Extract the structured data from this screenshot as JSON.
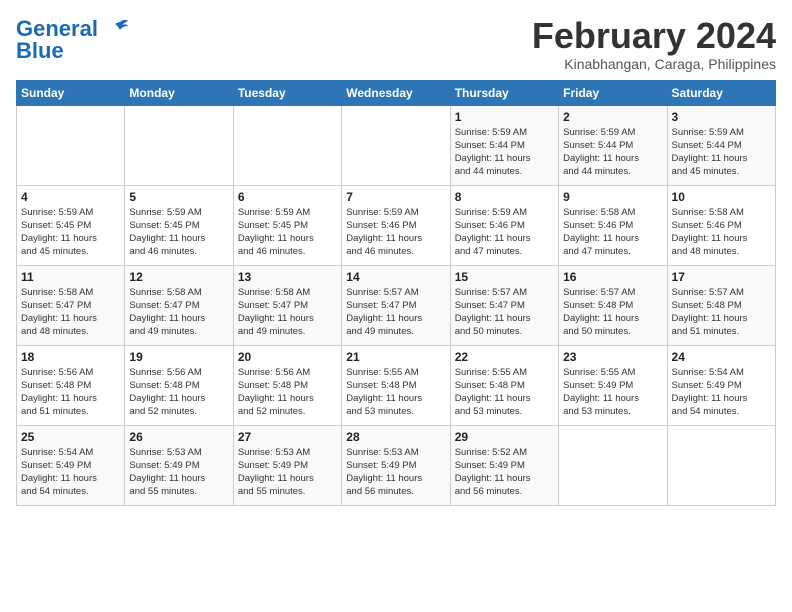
{
  "logo": {
    "line1": "General",
    "line2": "Blue"
  },
  "title": "February 2024",
  "subtitle": "Kinabhangan, Caraga, Philippines",
  "days_header": [
    "Sunday",
    "Monday",
    "Tuesday",
    "Wednesday",
    "Thursday",
    "Friday",
    "Saturday"
  ],
  "weeks": [
    [
      {
        "day": "",
        "info": ""
      },
      {
        "day": "",
        "info": ""
      },
      {
        "day": "",
        "info": ""
      },
      {
        "day": "",
        "info": ""
      },
      {
        "day": "1",
        "info": "Sunrise: 5:59 AM\nSunset: 5:44 PM\nDaylight: 11 hours\nand 44 minutes."
      },
      {
        "day": "2",
        "info": "Sunrise: 5:59 AM\nSunset: 5:44 PM\nDaylight: 11 hours\nand 44 minutes."
      },
      {
        "day": "3",
        "info": "Sunrise: 5:59 AM\nSunset: 5:44 PM\nDaylight: 11 hours\nand 45 minutes."
      }
    ],
    [
      {
        "day": "4",
        "info": "Sunrise: 5:59 AM\nSunset: 5:45 PM\nDaylight: 11 hours\nand 45 minutes."
      },
      {
        "day": "5",
        "info": "Sunrise: 5:59 AM\nSunset: 5:45 PM\nDaylight: 11 hours\nand 46 minutes."
      },
      {
        "day": "6",
        "info": "Sunrise: 5:59 AM\nSunset: 5:45 PM\nDaylight: 11 hours\nand 46 minutes."
      },
      {
        "day": "7",
        "info": "Sunrise: 5:59 AM\nSunset: 5:46 PM\nDaylight: 11 hours\nand 46 minutes."
      },
      {
        "day": "8",
        "info": "Sunrise: 5:59 AM\nSunset: 5:46 PM\nDaylight: 11 hours\nand 47 minutes."
      },
      {
        "day": "9",
        "info": "Sunrise: 5:58 AM\nSunset: 5:46 PM\nDaylight: 11 hours\nand 47 minutes."
      },
      {
        "day": "10",
        "info": "Sunrise: 5:58 AM\nSunset: 5:46 PM\nDaylight: 11 hours\nand 48 minutes."
      }
    ],
    [
      {
        "day": "11",
        "info": "Sunrise: 5:58 AM\nSunset: 5:47 PM\nDaylight: 11 hours\nand 48 minutes."
      },
      {
        "day": "12",
        "info": "Sunrise: 5:58 AM\nSunset: 5:47 PM\nDaylight: 11 hours\nand 49 minutes."
      },
      {
        "day": "13",
        "info": "Sunrise: 5:58 AM\nSunset: 5:47 PM\nDaylight: 11 hours\nand 49 minutes."
      },
      {
        "day": "14",
        "info": "Sunrise: 5:57 AM\nSunset: 5:47 PM\nDaylight: 11 hours\nand 49 minutes."
      },
      {
        "day": "15",
        "info": "Sunrise: 5:57 AM\nSunset: 5:47 PM\nDaylight: 11 hours\nand 50 minutes."
      },
      {
        "day": "16",
        "info": "Sunrise: 5:57 AM\nSunset: 5:48 PM\nDaylight: 11 hours\nand 50 minutes."
      },
      {
        "day": "17",
        "info": "Sunrise: 5:57 AM\nSunset: 5:48 PM\nDaylight: 11 hours\nand 51 minutes."
      }
    ],
    [
      {
        "day": "18",
        "info": "Sunrise: 5:56 AM\nSunset: 5:48 PM\nDaylight: 11 hours\nand 51 minutes."
      },
      {
        "day": "19",
        "info": "Sunrise: 5:56 AM\nSunset: 5:48 PM\nDaylight: 11 hours\nand 52 minutes."
      },
      {
        "day": "20",
        "info": "Sunrise: 5:56 AM\nSunset: 5:48 PM\nDaylight: 11 hours\nand 52 minutes."
      },
      {
        "day": "21",
        "info": "Sunrise: 5:55 AM\nSunset: 5:48 PM\nDaylight: 11 hours\nand 53 minutes."
      },
      {
        "day": "22",
        "info": "Sunrise: 5:55 AM\nSunset: 5:48 PM\nDaylight: 11 hours\nand 53 minutes."
      },
      {
        "day": "23",
        "info": "Sunrise: 5:55 AM\nSunset: 5:49 PM\nDaylight: 11 hours\nand 53 minutes."
      },
      {
        "day": "24",
        "info": "Sunrise: 5:54 AM\nSunset: 5:49 PM\nDaylight: 11 hours\nand 54 minutes."
      }
    ],
    [
      {
        "day": "25",
        "info": "Sunrise: 5:54 AM\nSunset: 5:49 PM\nDaylight: 11 hours\nand 54 minutes."
      },
      {
        "day": "26",
        "info": "Sunrise: 5:53 AM\nSunset: 5:49 PM\nDaylight: 11 hours\nand 55 minutes."
      },
      {
        "day": "27",
        "info": "Sunrise: 5:53 AM\nSunset: 5:49 PM\nDaylight: 11 hours\nand 55 minutes."
      },
      {
        "day": "28",
        "info": "Sunrise: 5:53 AM\nSunset: 5:49 PM\nDaylight: 11 hours\nand 56 minutes."
      },
      {
        "day": "29",
        "info": "Sunrise: 5:52 AM\nSunset: 5:49 PM\nDaylight: 11 hours\nand 56 minutes."
      },
      {
        "day": "",
        "info": ""
      },
      {
        "day": "",
        "info": ""
      }
    ]
  ]
}
